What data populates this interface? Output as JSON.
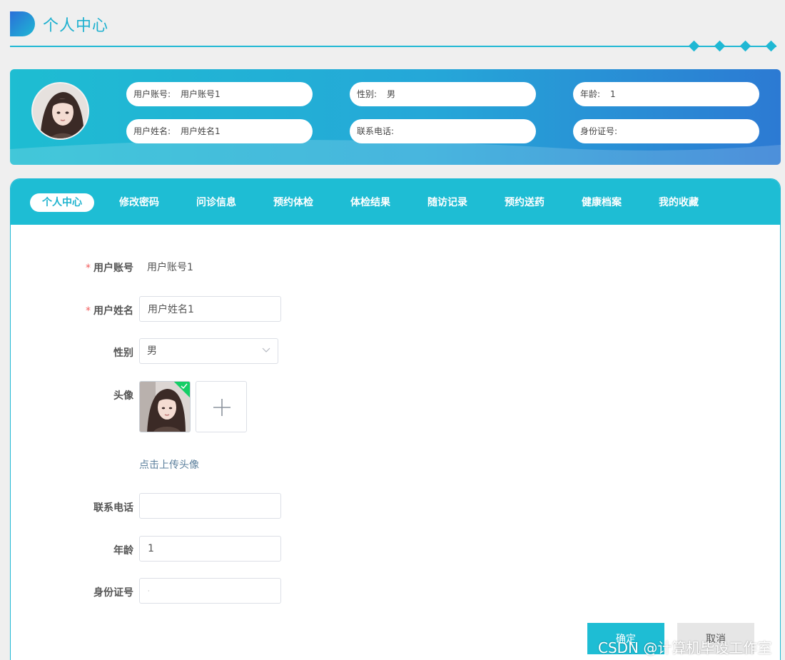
{
  "header": {
    "title": "个人中心"
  },
  "profile": {
    "account_label": "用户账号:",
    "account_value": "用户账号1",
    "gender_label": "性别:",
    "gender_value": "男",
    "age_label": "年龄:",
    "age_value": "1",
    "name_label": "用户姓名:",
    "name_value": "用户姓名1",
    "phone_label": "联系电话:",
    "phone_value": "",
    "idcard_label": "身份证号:",
    "idcard_value": ""
  },
  "tabs": [
    {
      "label": "个人中心",
      "active": true
    },
    {
      "label": "修改密码"
    },
    {
      "label": "问诊信息"
    },
    {
      "label": "预约体检"
    },
    {
      "label": "体检结果"
    },
    {
      "label": "随访记录"
    },
    {
      "label": "预约送药"
    },
    {
      "label": "健康档案"
    },
    {
      "label": "我的收藏"
    }
  ],
  "form": {
    "account_label": "用户账号",
    "account_value": "用户账号1",
    "name_label": "用户姓名",
    "name_value": "用户姓名1",
    "gender_label": "性别",
    "gender_value": "男",
    "avatar_label": "头像",
    "upload_hint": "点击上传头像",
    "phone_label": "联系电话",
    "phone_value": "",
    "age_label": "年龄",
    "age_value": "1",
    "idcard_label": "身份证号",
    "idcard_value": "·",
    "required_mark": "*"
  },
  "buttons": {
    "confirm": "确定",
    "cancel": "取消"
  },
  "watermark": "CSDN @计算机毕设工作室",
  "colors": {
    "accent": "#1ebdd4",
    "title": "#1db0cf",
    "banner_end": "#2c7ad3",
    "required": "#f15a5a",
    "upload_success": "#13ce66"
  }
}
